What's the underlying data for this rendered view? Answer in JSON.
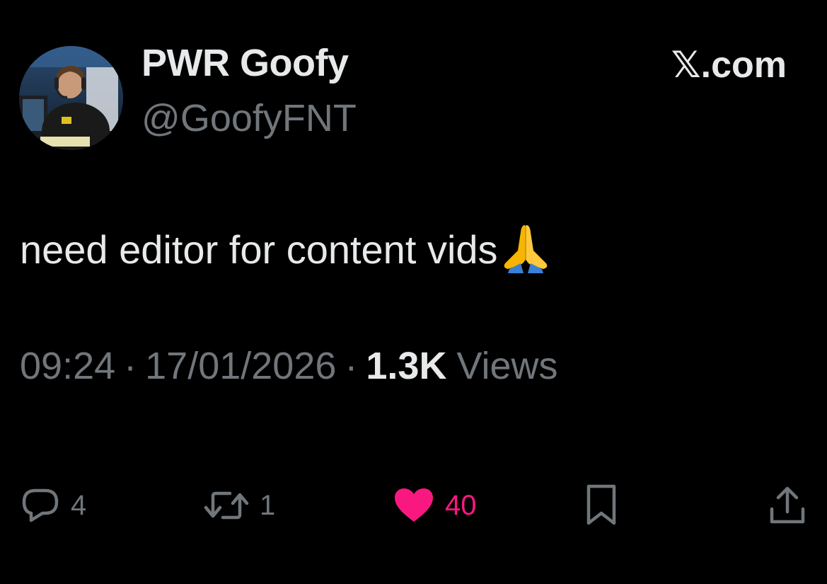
{
  "author": {
    "display_name": "PWR Goofy",
    "handle": "@GoofyFNT",
    "avatar_icon": "profile-photo"
  },
  "source": {
    "x_glyph": "𝕏",
    "label": ".com"
  },
  "tweet": {
    "text": "need editor for content vids",
    "emoji": "folded-hands-emoji"
  },
  "meta": {
    "time": "09:24",
    "separator": "·",
    "date": "17/01/2026",
    "views_count": "1.3K",
    "views_label": "Views"
  },
  "actions": {
    "reply_count": "4",
    "repost_count": "1",
    "like_count": "40",
    "bookmark_icon": "bookmark-icon",
    "share_icon": "share-icon"
  },
  "colors": {
    "background": "#000000",
    "primary_text": "#e7e9ea",
    "secondary_text": "#71767b",
    "like": "#f91880"
  }
}
